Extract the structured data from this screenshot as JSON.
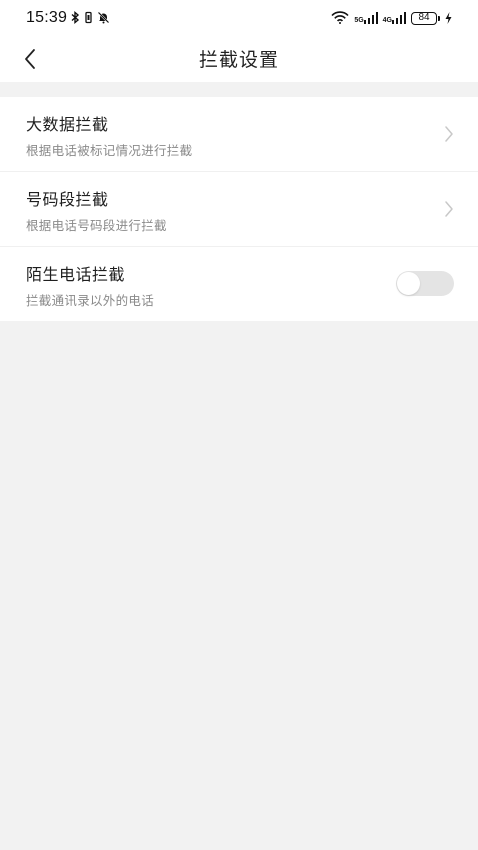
{
  "status_bar": {
    "time": "15:39",
    "net1": "5G",
    "net2": "4G",
    "battery": "84"
  },
  "header": {
    "title": "拦截设置"
  },
  "settings": [
    {
      "title": "大数据拦截",
      "subtitle": "根据电话被标记情况进行拦截",
      "control": "chevron"
    },
    {
      "title": "号码段拦截",
      "subtitle": "根据电话号码段进行拦截",
      "control": "chevron"
    },
    {
      "title": "陌生电话拦截",
      "subtitle": "拦截通讯录以外的电话",
      "control": "toggle",
      "enabled": false
    }
  ],
  "colors": {
    "background": "#f2f2f2",
    "card": "#ffffff",
    "toggle_off": "#e4e4e4",
    "subtitle": "#8a8a8a",
    "chevron": "#c8c8c8"
  }
}
